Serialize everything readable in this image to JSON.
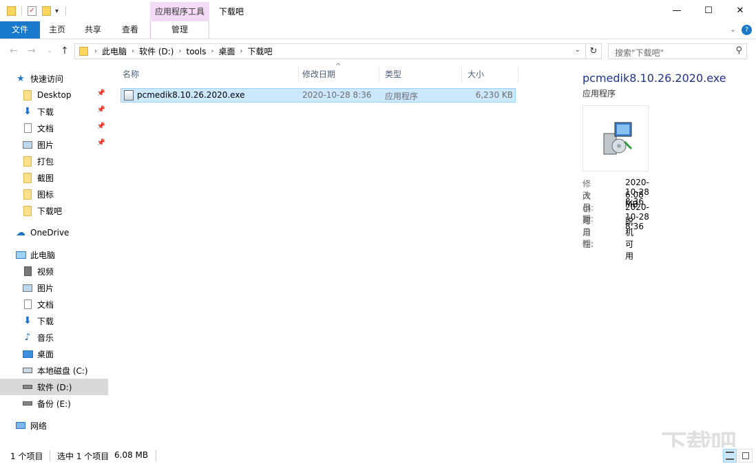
{
  "titlebar": {
    "title": "下载吧",
    "context_tab": "应用程序工具",
    "minimize": "—",
    "maximize": "☐",
    "close": "✕"
  },
  "ribbon": {
    "tabs": [
      "文件",
      "主页",
      "共享",
      "查看"
    ],
    "manage_tab": "管理"
  },
  "address": {
    "crumbs": [
      "此电脑",
      "软件 (D:)",
      "tools",
      "桌面",
      "下载吧"
    ],
    "search_placeholder": "搜索\"下载吧\""
  },
  "sidebar": {
    "quick_access": "快速访问",
    "quick_items": [
      "Desktop",
      "下载",
      "文档",
      "图片",
      "打包",
      "截图",
      "图标",
      "下载吧"
    ],
    "onedrive": "OneDrive",
    "this_pc": "此电脑",
    "pc_items": [
      "视频",
      "图片",
      "文档",
      "下载",
      "音乐",
      "桌面",
      "本地磁盘 (C:)",
      "软件 (D:)",
      "备份 (E:)"
    ],
    "network": "网络"
  },
  "columns": {
    "name": "名称",
    "modified": "修改日期",
    "type": "类型",
    "size": "大小"
  },
  "files": [
    {
      "name": "pcmedik8.10.26.2020.exe",
      "modified": "2020-10-28 8:36",
      "type": "应用程序",
      "size": "6,230 KB"
    }
  ],
  "preview": {
    "name": "pcmedik8.10.26.2020.exe",
    "type": "应用程序",
    "props": [
      {
        "key": "修改日期:",
        "value": "2020-10-28 8:36"
      },
      {
        "key": "大小:",
        "value": "6.08 MB"
      },
      {
        "key": "创建日期:",
        "value": "2020-10-28 8:36"
      },
      {
        "key": "可用性:",
        "value": "脱机可用"
      }
    ]
  },
  "status": {
    "count": "1 个项目",
    "selected": "选中 1 个项目",
    "selected_size": "6.08 MB"
  },
  "watermark": "下载吧"
}
